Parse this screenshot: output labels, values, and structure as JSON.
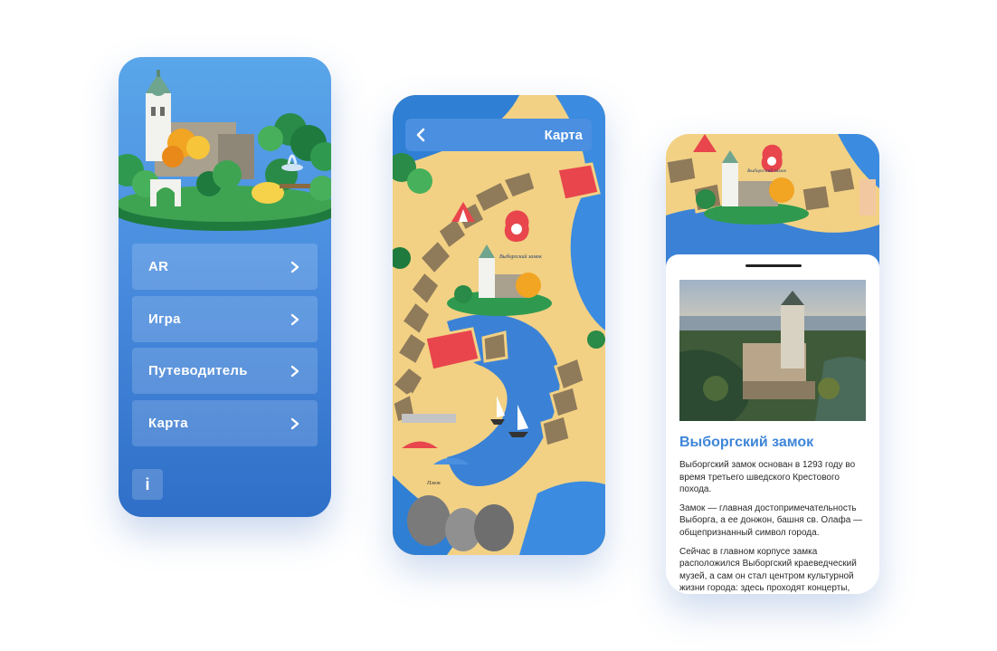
{
  "menu_screen": {
    "items": [
      {
        "label": "AR"
      },
      {
        "label": "Игра"
      },
      {
        "label": "Путеводитель"
      },
      {
        "label": "Карта"
      }
    ],
    "info_label": "i",
    "icon": "chevron-right-icon"
  },
  "map_screen": {
    "title": "Карта",
    "back_icon": "chevron-left-icon",
    "marker_label": "Выборгский замок",
    "beach_label": "Пляж"
  },
  "detail_screen": {
    "title": "Выборгский замок",
    "marker_label": "Выборгский замок",
    "paragraphs": [
      "Выборгский замок основан в 1293 году во время третьего шведского Крестового похода.",
      "Замок — главная достопримечательность Выборга, а ее донжон, башня св. Олафа — общепризнанный символ города.",
      "Сейчас в главном корпусе замка расположился Выборгский краеведческий музей, а сам он стал центром культурной жизни города: здесь проходят концерты,"
    ]
  },
  "colors": {
    "menu_bg": "#4a8ddf",
    "accent": "#3e86d8",
    "water": "#3b82d6",
    "sand": "#f2d184",
    "red_tile": "#e8454d"
  }
}
